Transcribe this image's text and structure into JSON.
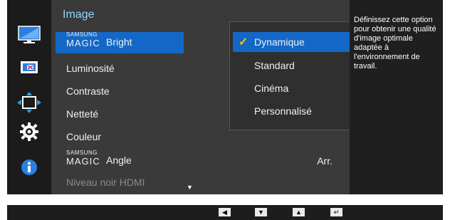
{
  "menu": {
    "title": "Image",
    "items": [
      {
        "brand": "SAMSUNG",
        "magic": "MAGIC",
        "label": "Bright"
      },
      {
        "label": "Luminosité"
      },
      {
        "label": "Contraste"
      },
      {
        "label": "Netteté"
      },
      {
        "label": "Couleur"
      },
      {
        "brand": "SAMSUNG",
        "magic": "MAGIC",
        "label": "Angle",
        "value": "Arr."
      },
      {
        "label": "Niveau noir HDMI"
      }
    ]
  },
  "dropdown": {
    "options": [
      "Dynamique",
      "Standard",
      "Cinéma",
      "Personnalisé"
    ],
    "selected": "Dynamique",
    "check": "✓"
  },
  "help": {
    "text": "Définissez cette option pour obtenir une qualité d'image optimale adaptée à l'environnement de travail."
  },
  "icons": {
    "scroll_down": "▼",
    "left": "◀",
    "down": "▼",
    "up": "▲",
    "enter": "↵"
  },
  "colors": {
    "accent": "#1368c7",
    "title": "#8fd8ff",
    "check": "#f7c000"
  }
}
